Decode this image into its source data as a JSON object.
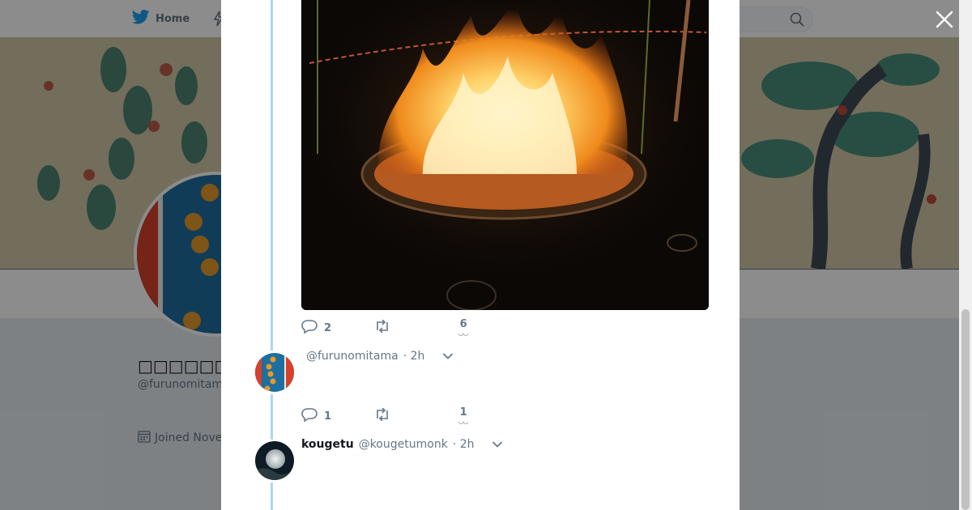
{
  "window": {
    "width": 1200,
    "height": 630
  },
  "topbar": {
    "home_label": "Home",
    "icons": [
      "twitter-bird-icon",
      "moments-bolt-icon",
      "search-icon"
    ]
  },
  "profile": {
    "name": "□□□□□□□□□□□",
    "handle": "@furunomitama",
    "joined": "Joined Nove"
  },
  "modal": {
    "close_icon": "close-icon",
    "tweets": [
      {
        "media": "fire-ritual-photo",
        "reply_count": "2",
        "retweet_count": "",
        "like_count": "6",
        "like_swirl": "◡◡"
      },
      {
        "display_name": "",
        "handle": "@furunomitama",
        "time": "· 2h",
        "reply_count": "1",
        "retweet_count": "",
        "like_count": "1",
        "like_swirl": "◡◡"
      },
      {
        "display_name": "kougetu",
        "handle": "@kougetumonk",
        "time": "· 2h"
      }
    ]
  },
  "colors": {
    "accent": "#1da1f2",
    "muted": "#657786",
    "thread_line": "#aad8f0",
    "overlay": "rgba(0,0,0,0.45)"
  }
}
